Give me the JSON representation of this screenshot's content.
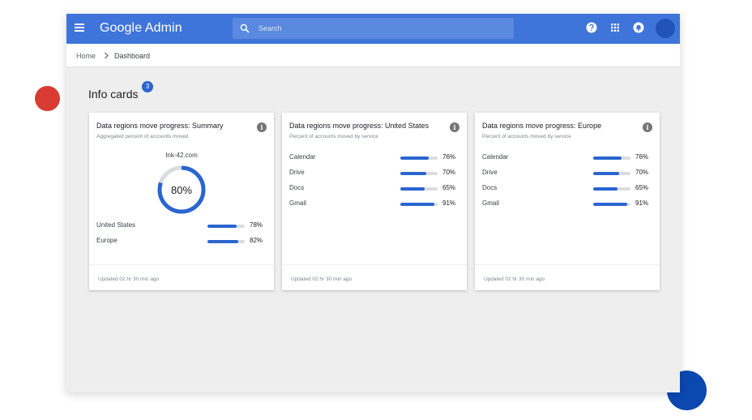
{
  "header": {
    "brand": "Google Admin",
    "search_placeholder": "Search"
  },
  "breadcrumb": {
    "home": "Home",
    "current": "Dashboard"
  },
  "section": {
    "title": "Info cards",
    "count": "3"
  },
  "colors": {
    "topbar": "#3f74da",
    "accent": "#2a65d0",
    "track": "#dadce0",
    "deco_red": "#d93a31",
    "deco_blue": "#0b48b0"
  },
  "icons": {
    "menu": "hamburger-icon",
    "search": "search-icon",
    "help": "help-icon",
    "apps": "apps-grid-icon",
    "notifications": "bell-icon",
    "info": "info-icon"
  },
  "cards": [
    {
      "title": "Data regions move progress: Summary",
      "subtitle": "Aggregated percent of accounts moved",
      "domain": "Ink-42.com",
      "summary_value": 80,
      "summary_label": "80%",
      "rows": [
        {
          "label": "United States",
          "value": 78,
          "pct": "78%"
        },
        {
          "label": "Europe",
          "value": 82,
          "pct": "82%"
        }
      ],
      "footer": "Updated 02 hr 30 min ago"
    },
    {
      "title": "Data regions move progress: United States",
      "subtitle": "Percent of accounts moved by service",
      "rows": [
        {
          "label": "Calendar",
          "value": 76,
          "pct": "76%"
        },
        {
          "label": "Drive",
          "value": 70,
          "pct": "70%"
        },
        {
          "label": "Docs",
          "value": 65,
          "pct": "65%"
        },
        {
          "label": "Gmail",
          "value": 91,
          "pct": "91%"
        }
      ],
      "footer": "Updated 02 hr 30 min ago"
    },
    {
      "title": "Data regions move progress: Europe",
      "subtitle": "Percent of accounts moved by service",
      "rows": [
        {
          "label": "Calendar",
          "value": 76,
          "pct": "76%"
        },
        {
          "label": "Drive",
          "value": 70,
          "pct": "70%"
        },
        {
          "label": "Docs",
          "value": 65,
          "pct": "65%"
        },
        {
          "label": "Gmail",
          "value": 91,
          "pct": "91%"
        }
      ],
      "footer": "Updated 02 hr 30 min ago"
    }
  ]
}
